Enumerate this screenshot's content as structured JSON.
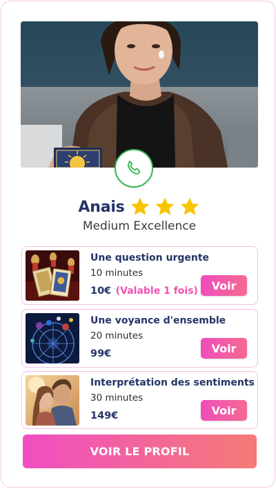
{
  "advisor": {
    "name": "Anais",
    "rating_stars": 3,
    "title": "Medium Excellence"
  },
  "offers": [
    {
      "title": "Une question urgente",
      "duration": "10 minutes",
      "price": "10€",
      "note": "(Valable 1 fois)",
      "button_label": "Voir",
      "image_icon": "tarot-candles-image"
    },
    {
      "title": "Une voyance d'ensemble",
      "duration": "20 minutes",
      "price": "99€",
      "note": "",
      "button_label": "Voir",
      "image_icon": "astrology-chart-image"
    },
    {
      "title": "Interprétation des sentiments",
      "duration": "30 minutes",
      "price": "149€",
      "note": "",
      "button_label": "Voir",
      "image_icon": "couple-image"
    }
  ],
  "cta": {
    "profile_label": "VOIR LE PROFIL"
  },
  "icons": {
    "call": "phone-icon",
    "rating": "star-icon"
  },
  "colors": {
    "brand_pink": "#f04dbd",
    "brand_coral": "#f57b76",
    "navy_text": "#233566",
    "star_gold": "#f9c300",
    "call_green": "#35b653",
    "card_border": "#f2bde0"
  }
}
